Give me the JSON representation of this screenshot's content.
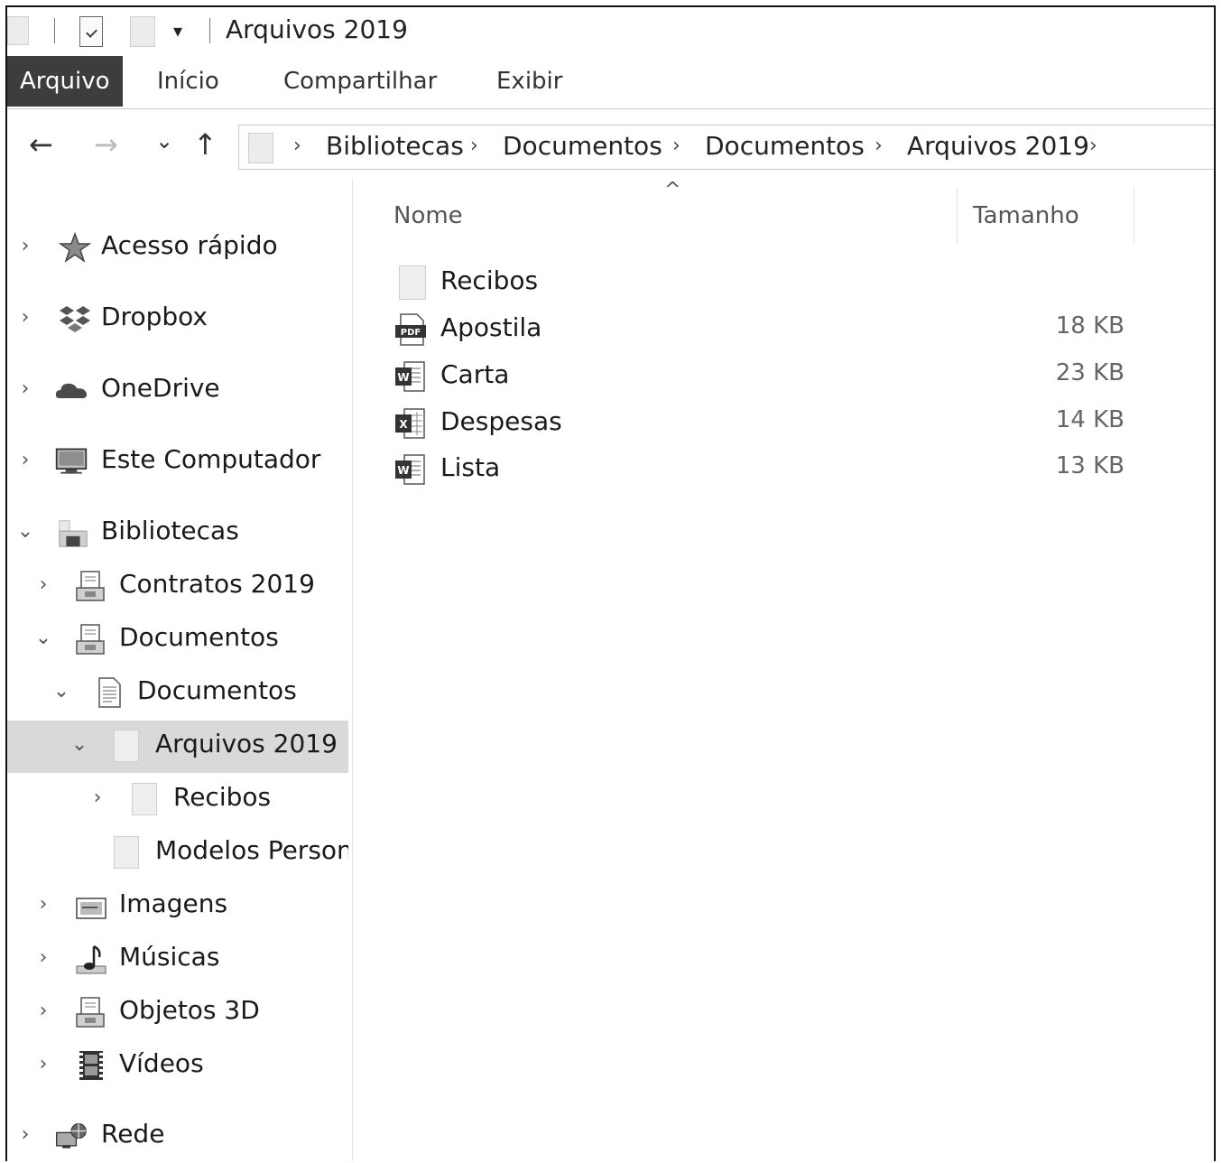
{
  "window": {
    "title": "Arquivos 2019"
  },
  "ribbon": {
    "tabs": [
      {
        "label": "Arquivo"
      },
      {
        "label": "Início"
      },
      {
        "label": "Compartilhar"
      },
      {
        "label": "Exibir"
      }
    ]
  },
  "navigation": {
    "back": "←",
    "forward": "→",
    "recent": "⌄",
    "up": "↑"
  },
  "address": {
    "crumbs": [
      "Bibliotecas",
      "Documentos",
      "Documentos",
      "Arquivos 2019"
    ],
    "separator": "›"
  },
  "navpane": {
    "items": [
      {
        "label": "Acesso rápido",
        "icon": "star-icon",
        "chevron": "›"
      },
      {
        "label": "Dropbox",
        "icon": "dropbox-icon",
        "chevron": "›"
      },
      {
        "label": "OneDrive",
        "icon": "cloud-icon",
        "chevron": "›"
      },
      {
        "label": "Este Computador",
        "icon": "computer-icon",
        "chevron": "›"
      },
      {
        "label": "Bibliotecas",
        "icon": "libraries-icon",
        "chevron": "⌄"
      },
      {
        "label": "Contratos 2019",
        "icon": "library-icon",
        "chevron": "›"
      },
      {
        "label": "Documentos",
        "icon": "library-icon",
        "chevron": "⌄"
      },
      {
        "label": "Documentos",
        "icon": "document-icon",
        "chevron": "⌄"
      },
      {
        "label": "Arquivos 2019",
        "icon": "folder-icon",
        "chevron": "⌄"
      },
      {
        "label": "Recibos",
        "icon": "folder-icon",
        "chevron": "›"
      },
      {
        "label": "Modelos Personalizados",
        "icon": "folder-icon",
        "chevron": ""
      },
      {
        "label": "Imagens",
        "icon": "pictures-icon",
        "chevron": "›"
      },
      {
        "label": "Músicas",
        "icon": "music-icon",
        "chevron": "›"
      },
      {
        "label": "Objetos 3D",
        "icon": "library-icon",
        "chevron": "›"
      },
      {
        "label": "Vídeos",
        "icon": "video-icon",
        "chevron": "›"
      },
      {
        "label": "Rede",
        "icon": "network-icon",
        "chevron": "›"
      }
    ]
  },
  "content": {
    "columns": {
      "name": "Nome",
      "size": "Tamanho",
      "sort_indicator": "^"
    },
    "files": [
      {
        "name": "Recibos",
        "size": "",
        "icon": "folder-icon"
      },
      {
        "name": "Apostila",
        "size": "18 KB",
        "icon": "pdf-icon",
        "icon_text": "PDF"
      },
      {
        "name": "Carta",
        "size": "23 KB",
        "icon": "word-icon",
        "icon_text": "W"
      },
      {
        "name": "Despesas",
        "size": "14 KB",
        "icon": "excel-icon",
        "icon_text": "X"
      },
      {
        "name": "Lista",
        "size": "13 KB",
        "icon": "word-icon",
        "icon_text": "W"
      }
    ]
  }
}
